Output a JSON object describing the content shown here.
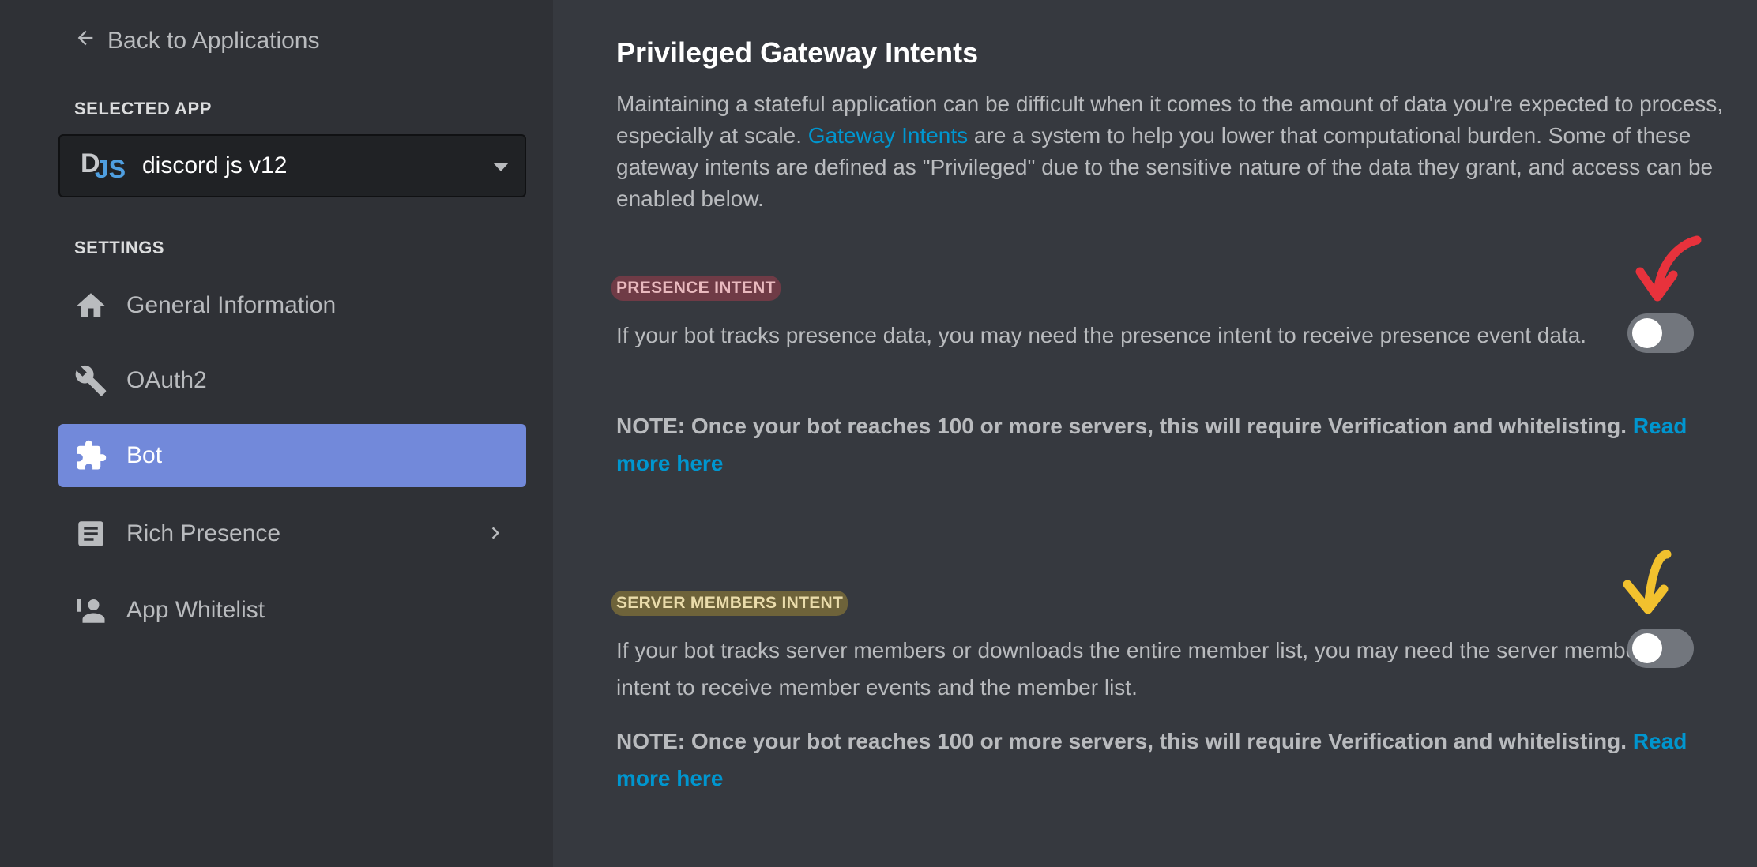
{
  "sidebar": {
    "back_label": "Back to Applications",
    "selected_app_heading": "SELECTED APP",
    "app": {
      "logo_d": "D",
      "logo_js": "JS",
      "name": "discord js v12"
    },
    "settings_heading": "SETTINGS",
    "nav": [
      {
        "label": "General Information",
        "icon": "home-icon"
      },
      {
        "label": "OAuth2",
        "icon": "wrench-icon"
      },
      {
        "label": "Bot",
        "icon": "puzzle-icon",
        "active": true
      },
      {
        "label": "Rich Presence",
        "icon": "document-icon",
        "has_submenu": true
      },
      {
        "label": "App Whitelist",
        "icon": "user-icon"
      }
    ]
  },
  "main": {
    "title": "Privileged Gateway Intents",
    "description": {
      "before": "Maintaining a stateful application can be difficult when it comes to the amount of data you're expected to process, especially at scale. ",
      "link": "Gateway Intents",
      "after": " are a system to help you lower that computational burden. Some of these gateway intents are defined as \"Privileged\" due to the sensitive nature of the data they grant, and access can be enabled below."
    },
    "intents": [
      {
        "label": "PRESENCE INTENT",
        "description": "If your bot tracks presence data, you may need the presence intent to receive presence event data.",
        "note": "NOTE: Once your bot reaches 100 or more servers, this will require Verification and whitelisting.",
        "note_link": "Read more here",
        "enabled": false,
        "highlight_color": "#d94054"
      },
      {
        "label": "SERVER MEMBERS INTENT",
        "description": "If your bot tracks server members or downloads the entire member list, you may need the server members intent to receive member events and the member list.",
        "note": "NOTE: Once your bot reaches 100 or more servers, this will require Verification and whitelisting.",
        "note_link": "Read more here",
        "enabled": false,
        "highlight_color": "#d6b330"
      }
    ]
  },
  "colors": {
    "sidebar_bg": "#2f3136",
    "main_bg": "#36393f",
    "accent": "#7289da",
    "link": "#0096cf",
    "toggle_off": "#72767d",
    "arrow_red": "#e8323c",
    "arrow_yellow": "#f2c12e"
  }
}
